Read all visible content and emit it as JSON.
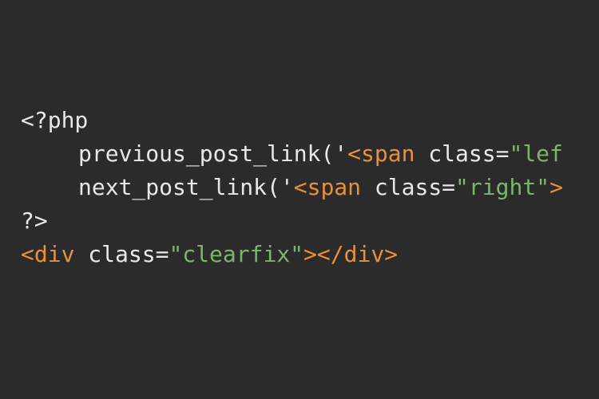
{
  "code": {
    "line1": {
      "php_open": "<?php"
    },
    "line2": {
      "func": "previous_post_link",
      "paren_quote": "('",
      "span_open": "<span",
      "class_attr": " class=",
      "class_val": "\"lef"
    },
    "line3": {
      "func": "next_post_link",
      "paren_quote": "('",
      "span_open": "<span",
      "class_attr": " class=",
      "class_val": "\"right\"",
      "gt": ">"
    },
    "line4": {
      "php_close": "?>"
    },
    "line5": {
      "div_open": "<div",
      "class_attr": " class=",
      "class_val": "\"clearfix\"",
      "gt1": ">",
      "div_close": "</div>"
    }
  }
}
